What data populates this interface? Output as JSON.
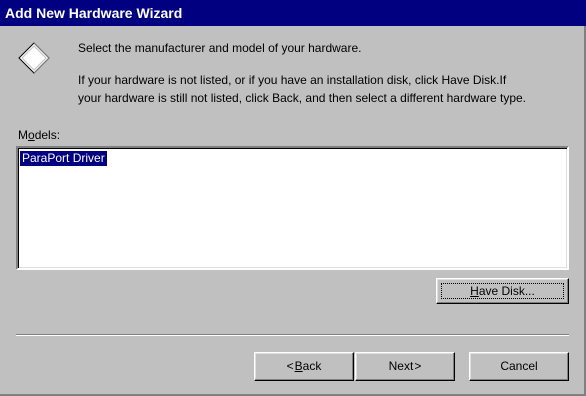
{
  "window": {
    "title": "Add New Hardware Wizard",
    "accent_color": "#000080",
    "background_color": "#c0c0c0"
  },
  "header": {
    "icon": "diamond-wizard-icon",
    "instruction": "Select the manufacturer and model of your hardware.",
    "note_line1": "If your hardware is not listed, or if you have an installation disk, click Have Disk.If",
    "note_line2": "your hardware is still not listed, click Back, and then select a different hardware type."
  },
  "models": {
    "label_accel": "o",
    "label_pre": "M",
    "label_post": "dels:",
    "items": [
      {
        "label": "ParaPort Driver",
        "selected": true
      }
    ]
  },
  "have_disk": {
    "accel": "H",
    "rest": "ave Disk..."
  },
  "footer": {
    "back_arrow": "<",
    "back_accel": "B",
    "back_rest": "ack",
    "next_label": "Next",
    "next_arrow": ">",
    "cancel_label": "Cancel"
  }
}
